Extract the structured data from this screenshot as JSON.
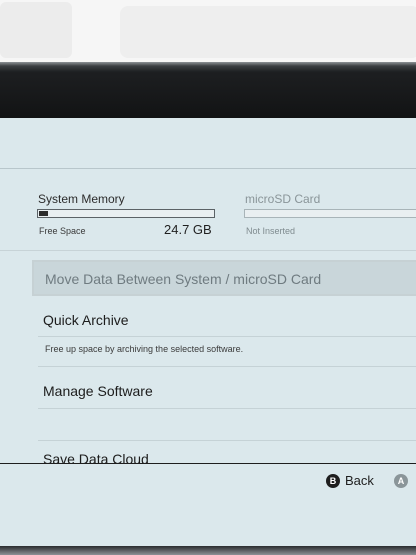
{
  "storage": {
    "system": {
      "title": "System Memory",
      "free_label": "Free Space",
      "free_value": "24.7 GB",
      "used_fraction": 0.05
    },
    "microsd": {
      "title": "microSD Card",
      "status": "Not Inserted"
    }
  },
  "menu": {
    "move_data": "Move Data Between System / microSD Card",
    "quick_archive": "Quick Archive",
    "quick_archive_desc": "Free up space by archiving the selected software.",
    "manage_software": "Manage Software",
    "save_data_cloud": "Save Data Cloud"
  },
  "footer": {
    "back_button_glyph": "B",
    "back_label": "Back",
    "ok_button_glyph": "A"
  },
  "colors": {
    "screen_bg": "#dbe8ec",
    "selected_bg": "#c9d6da",
    "text": "#1c1c1c"
  }
}
